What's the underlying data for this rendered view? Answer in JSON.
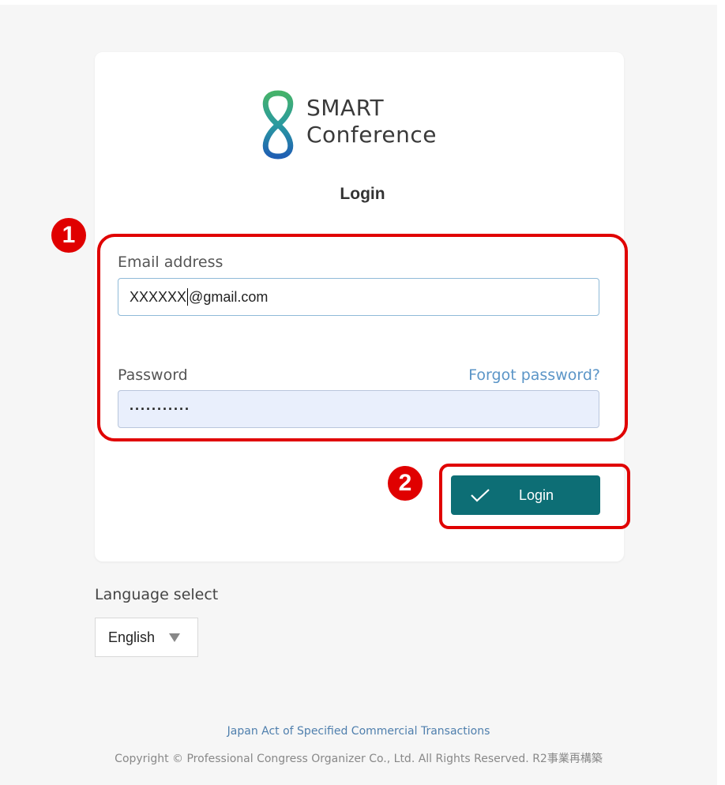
{
  "brand": {
    "line1": "SMART",
    "line2": "Conference"
  },
  "login": {
    "heading": "Login",
    "email_label": "Email address",
    "email_value_before_cursor": "XXXXXX",
    "email_value_after_cursor": "@gmail.com",
    "password_label": "Password",
    "forgot_label": "Forgot password?",
    "password_masked": "···········",
    "submit_label": "Login"
  },
  "annotations": {
    "step1": "1",
    "step2": "2",
    "highlight_color": "#e00000"
  },
  "language": {
    "label": "Language select",
    "selected": "English"
  },
  "footer": {
    "legal_link": "Japan Act of Specified Commercial Transactions",
    "copyright": "Copyright © Professional Congress Organizer Co., Ltd. All Rights Reserved. R2事業再構築"
  },
  "colors": {
    "accent": "#0d6e75",
    "link": "#5b95c7",
    "logo_green": "#2e9a6b",
    "logo_blue": "#1f6fb8"
  }
}
